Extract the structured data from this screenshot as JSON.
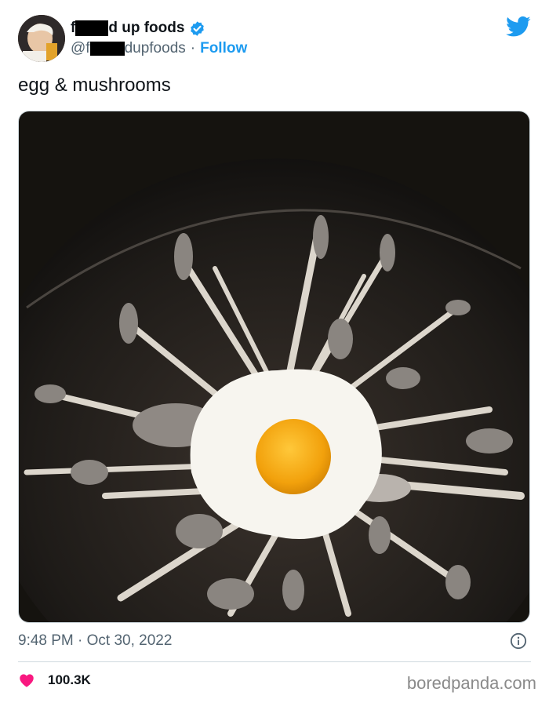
{
  "author": {
    "name_prefix": "f",
    "name_suffix": "d up foods",
    "handle_prefix": "@f",
    "handle_suffix": "dupfoods",
    "dot": "·",
    "follow_label": "Follow",
    "verified": true
  },
  "tweet": {
    "text": "egg & mushrooms"
  },
  "meta": {
    "timestamp": "9:48 PM · Oct 30, 2022",
    "likes": "100.3K"
  },
  "watermark": "boredpanda.com",
  "colors": {
    "accent": "#1d9bf0",
    "heart": "#f91880",
    "text": "#0f1419",
    "secondary": "#536471"
  },
  "icons": {
    "brand": "twitter-bird-icon",
    "verified": "verified-badge-icon",
    "info": "info-icon",
    "like": "heart-icon"
  }
}
